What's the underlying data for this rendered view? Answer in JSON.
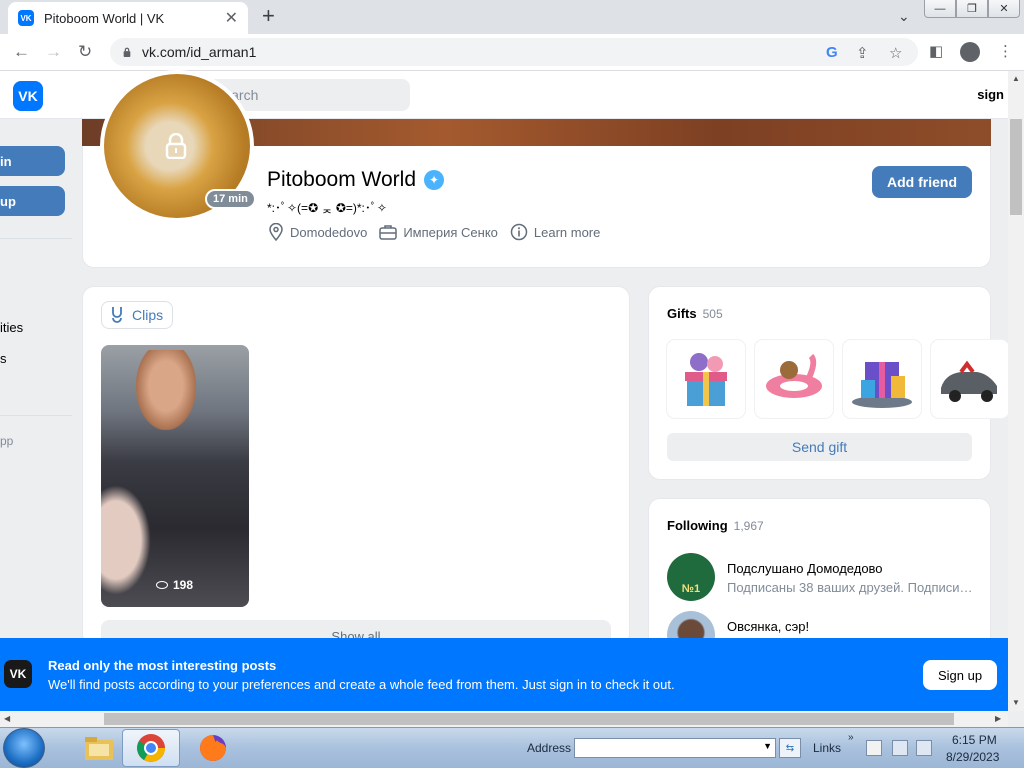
{
  "browser": {
    "tab_title": "Pitoboom World | VK",
    "tab_favicon": "vk-icon",
    "url": "vk.com/id_arman1",
    "win_buttons": [
      "minimize-icon",
      "restore-icon",
      "close-icon"
    ]
  },
  "header": {
    "search_placeholder": "Search",
    "signin_label": "sign"
  },
  "sidebar": {
    "btn1": "in",
    "btn2": "up",
    "item1": "ities",
    "item2": "s",
    "item3": "pp"
  },
  "profile": {
    "name": "Pitoboom World",
    "status": "*:･ﾟ✧(=✪ ᆽ ✪=)*:･ﾟ✧",
    "last_seen": "17 min",
    "location": "Domodedovo",
    "work": "Империя Сенко",
    "learn_more": "Learn more",
    "add_friend": "Add friend",
    "verified_icon": "verified-icon"
  },
  "clips": {
    "label": "Clips",
    "views": "198",
    "show_all": "Show all"
  },
  "gifts": {
    "title": "Gifts",
    "count": "505",
    "send_label": "Send gift",
    "items": [
      "gift-box-icon",
      "flamingo-float-icon",
      "present-stack-icon",
      "car-icon"
    ]
  },
  "following": {
    "title": "Following",
    "count": "1,967",
    "items": [
      {
        "name": "Подслушано Домодедово",
        "sub": "Подписаны 38 ваших друзей. Подписи…",
        "avatar_text": "№1"
      },
      {
        "name": "Овсянка, сэр!",
        "sub": ""
      }
    ]
  },
  "banner": {
    "title": "Read only the most interesting posts",
    "subtitle": "We'll find posts according to your preferences and create a whole feed from them. Just sign in to check it out.",
    "button": "Sign up"
  },
  "taskbar": {
    "address_label": "Address",
    "links_label": "Links",
    "time": "6:15 PM",
    "date": "8/29/2023"
  },
  "colors": {
    "vk_blue": "#0077ff",
    "button_blue": "#447bba"
  }
}
